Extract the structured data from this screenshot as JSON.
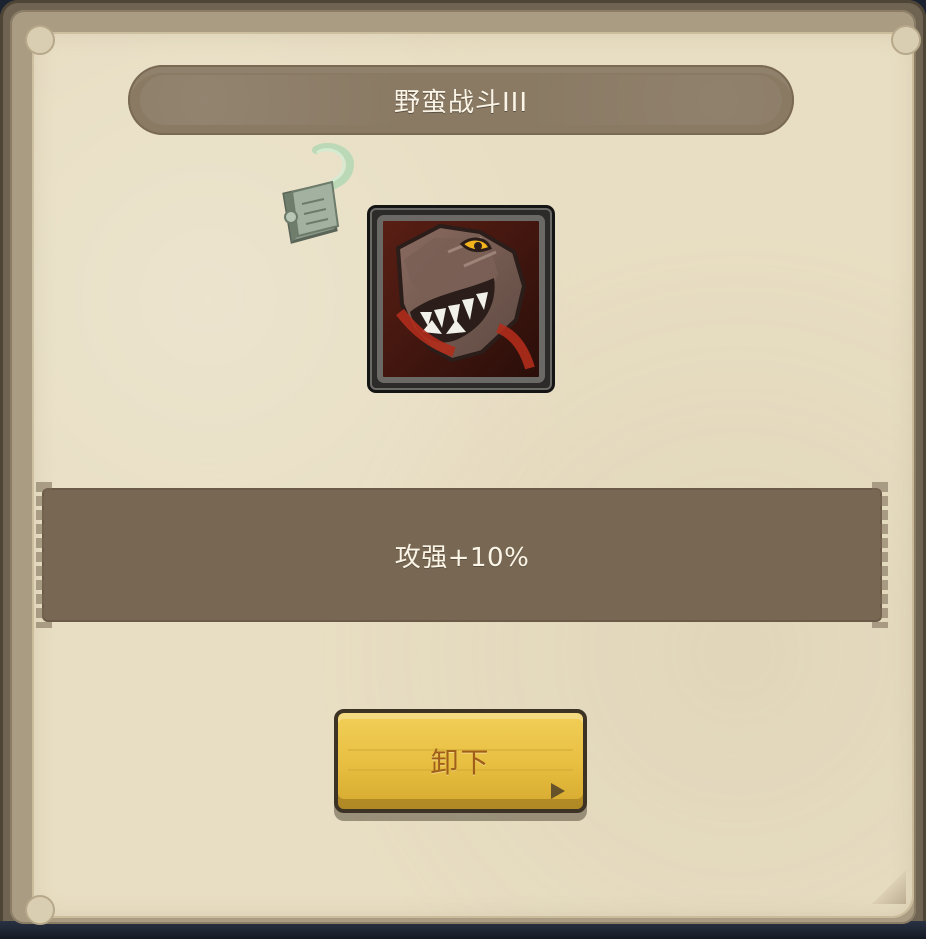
{
  "dialog": {
    "title": "野蛮战斗III",
    "description": "攻强+10%",
    "unequip_label": "卸下"
  },
  "icons": {
    "book": "spellbook-icon",
    "skill": "wolf-skill-icon"
  },
  "colors": {
    "title_banner": "#8a7a64",
    "description_bar": "#786853",
    "button_fill": "#e7be40",
    "button_text": "#a05e19",
    "paper": "#e8dec3"
  }
}
